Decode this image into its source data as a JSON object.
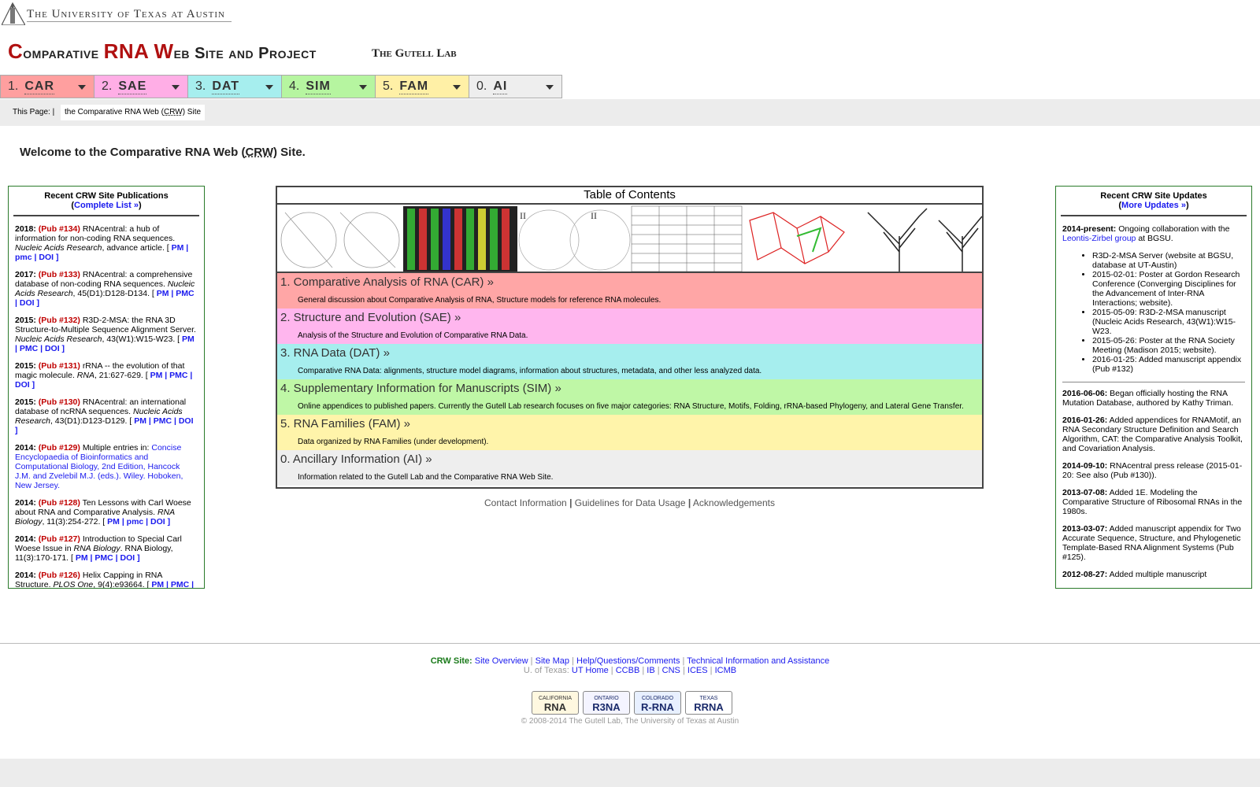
{
  "header": {
    "university": "The University of Texas at Austin",
    "site_title_parts": [
      {
        "cap": "C",
        "rest": "omparative "
      },
      {
        "cap": "RNA",
        "rest": " "
      },
      {
        "cap": "W",
        "rest": "eb "
      },
      {
        "cap": "S",
        "rest": "ite and "
      },
      {
        "cap": "P",
        "rest": "roject"
      }
    ],
    "site_title_c": "C",
    "site_title_1": "omparative ",
    "site_title_rna": "RNA",
    "site_title_w": "W",
    "site_title_2": "eb Site and Project",
    "lab_title": "The Gutell Lab"
  },
  "nav": {
    "tabs": [
      {
        "num": "1.",
        "abbr": "CAR",
        "color": "#ff9f9f"
      },
      {
        "num": "2.",
        "abbr": "SAE",
        "color": "#ffaee6"
      },
      {
        "num": "3.",
        "abbr": "DAT",
        "color": "#a6eeee"
      },
      {
        "num": "4.",
        "abbr": "SIM",
        "color": "#b6f5a0"
      },
      {
        "num": "5.",
        "abbr": "FAM",
        "color": "#fff0a6"
      },
      {
        "num": "0.",
        "abbr": "AI",
        "color": "#eeeeee"
      }
    ]
  },
  "subbar": {
    "label": "This Page: |",
    "pill_pre": "the Comparative RNA Web (",
    "pill_abbr": "CRW",
    "pill_post": ") Site"
  },
  "welcome": {
    "pre": "Welcome to the Comparative RNA Web (",
    "abbr": "CRW",
    "post": ") Site."
  },
  "publications": {
    "title": "Recent CRW Site Publications",
    "more_open": "(",
    "more_link": "Complete List »",
    "more_close": ")",
    "items": [
      {
        "year": "2018:",
        "pub": "(Pub #134)",
        "text": "RNAcentral: a hub of information for non-coding RNA sequences.",
        "journal": "Nucleic Acids Research",
        "rest": ", advance article. [",
        "links": "PM | pmc | DOI ]"
      },
      {
        "year": "2017:",
        "pub": "(Pub #133)",
        "text": "RNAcentral: a comprehensive database of non-coding RNA sequences.",
        "journal": "Nucleic Acids Research",
        "rest": ", 45(D1):D128-D134. [",
        "links": "PM | PMC | DOI ]"
      },
      {
        "year": "2015:",
        "pub": "(Pub #132)",
        "text": "R3D-2-MSA: the RNA 3D Structure-to-Multiple Sequence Alignment Server.",
        "journal": "Nucleic Acids Research",
        "rest": ", 43(W1):W15-W23. [",
        "links": "PM | PMC | DOI ]"
      },
      {
        "year": "2015:",
        "pub": "(Pub #131)",
        "text": "rRNA -- the evolution of that magic molecule.",
        "journal": "RNA",
        "rest": ", 21:627-629. [",
        "links": "PM | PMC | DOI ]"
      },
      {
        "year": "2015:",
        "pub": "(Pub #130)",
        "text": "RNAcentral: an international database of ncRNA sequences.",
        "journal": "Nucleic Acids Research",
        "rest": ", 43(D1):D123-D129. [",
        "links": "PM | PMC | DOI ]"
      },
      {
        "year": "2014:",
        "pub": "(Pub #129)",
        "text": "Multiple entries in:",
        "journal": "",
        "rest": "Concise Encyclopaedia of Bioinformatics and Computational Biology, 2nd Edition, Hancock J.M. and Zvelebil M.J. (eds.). Wiley. Hoboken, New Jersey.",
        "links": ""
      },
      {
        "year": "2014:",
        "pub": "(Pub #128)",
        "text": "Ten Lessons with Carl Woese about RNA and Comparative Analysis.",
        "journal": "RNA Biology",
        "rest": ", 11(3):254-272. [",
        "links": "PM | pmc | DOI ]"
      },
      {
        "year": "2014:",
        "pub": "(Pub #127)",
        "text": "Introduction to Special Carl Woese Issue in",
        "journal": "RNA Biology",
        "rest": ". RNA Biology, 11(3):170-171. [",
        "links": "PM | PMC | DOI ]"
      },
      {
        "year": "2014:",
        "pub": "(Pub #126)",
        "text": "Helix Capping in RNA Structure.",
        "journal": "PLOS One",
        "rest": ", 9(4):e93664. [",
        "links": "PM | PMC |"
      }
    ]
  },
  "updates": {
    "title": "Recent CRW Site Updates",
    "more_open": "(",
    "more_link": "More Updates »",
    "more_close": ")",
    "intro_date": "2014-present:",
    "intro_text": "Ongoing collaboration with the",
    "intro_link": "Leontis-Zirbel group",
    "intro_tail": "at BGSU.",
    "bullets": [
      "R3D-2-MSA Server (website at BGSU, database at UT-Austin)",
      "2015-02-01: Poster at Gordon Research Conference (Converging Disciplines for the Advancement of Inter-RNA Interactions; website).",
      "2015-05-09: R3D-2-MSA manuscript (Nucleic Acids Research, 43(W1):W15-W23.",
      "2015-05-26: Poster at the RNA Society Meeting (Madison 2015; website).",
      "2016-01-25: Added manuscript appendix (Pub #132)"
    ],
    "entries": [
      {
        "date": "2016-06-06:",
        "text": "Began officially hosting the RNA Mutation Database, authored by Kathy Triman."
      },
      {
        "date": "2016-01-26:",
        "text": "Added appendices for RNAMotif, an RNA Secondary Structure Definition and Search Algorithm, CAT: the Comparative Analysis Toolkit, and Covariation Analysis."
      },
      {
        "date": "2014-09-10:",
        "text": "RNAcentral press release (2015-01-20: See also (Pub #130))."
      },
      {
        "date": "2013-07-08:",
        "text": "Added 1E. Modeling the Comparative Structure of Ribosomal RNAs in the 1980s."
      },
      {
        "date": "2013-03-07:",
        "text": "Added manuscript appendix for Two Accurate Sequence, Structure, and Phylogenetic Template-Based RNA Alignment Systems (Pub #125)."
      },
      {
        "date": "2012-08-27:",
        "text": "Added multiple manuscript"
      }
    ]
  },
  "toc": {
    "title": "Table of Contents",
    "sections": [
      {
        "title": "1. Comparative Analysis of RNA (CAR) »",
        "desc": "General discussion about Comparative Analysis of RNA, Structure models for reference RNA molecules.",
        "color": "#ffa6a6"
      },
      {
        "title": "2. Structure and Evolution (SAE) »",
        "desc": "Analysis of the Structure and Evolution of Comparative RNA Data.",
        "color": "#ffb6ee"
      },
      {
        "title": "3. RNA Data (DAT) »",
        "desc": "Comparative RNA Data: alignments, structure model diagrams, information about structures, metadata, and other less analyzed data.",
        "color": "#a6eeee"
      },
      {
        "title": "4. Supplementary Information for Manuscripts (SIM) »",
        "desc": "Online appendices to published papers. Currently the Gutell Lab research focuses on five major categories: RNA Structure, Motifs, Folding, rRNA-based Phylogeny, and Lateral Gene Transfer.",
        "color": "#bff7a6"
      },
      {
        "title": "5. RNA Families (FAM) »",
        "desc": "Data organized by RNA Families (under development).",
        "color": "#fff4aa"
      },
      {
        "title": "0. Ancillary Information (AI) »",
        "desc": "Information related to the Gutell Lab and the Comparative RNA Web Site.",
        "color": "#eeeeee"
      }
    ]
  },
  "mid_links": [
    "Contact Information",
    "Guidelines for Data Usage",
    "Acknowledgements"
  ],
  "footer": {
    "crw_label": "CRW Site:",
    "crw_links": [
      "Site Overview",
      "Site Map",
      "Help/Questions/Comments",
      "Technical Information and Assistance"
    ],
    "ut_label": "U. of Texas:",
    "ut_links": [
      "UT Home",
      "CCBB",
      "IB",
      "CNS",
      "ICES",
      "ICMB"
    ],
    "plates": [
      {
        "top": "CALIFORNIA",
        "main": "RNA"
      },
      {
        "top": "ONTARIO",
        "main": "R3NA"
      },
      {
        "top": "COLORADO",
        "main": "R-RNA"
      },
      {
        "top": "TEXAS",
        "main": "RRNA"
      }
    ],
    "copyright": "© 2008-2014 The Gutell Lab, The University of Texas at Austin"
  }
}
